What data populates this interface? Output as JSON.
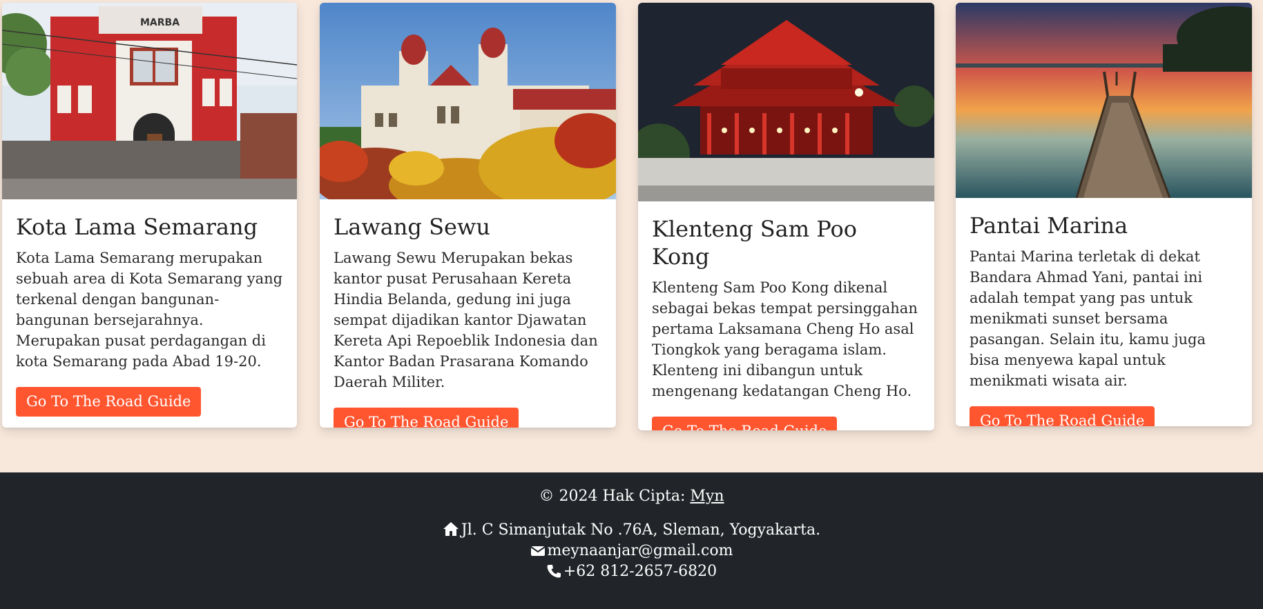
{
  "cards": [
    {
      "title": "Kota Lama Semarang",
      "text": "Kota Lama Semarang merupakan sebuah area di Kota Semarang yang terkenal dengan bangunan-bangunan bersejarahnya. Merupakan pusat perdagangan di kota Semarang pada Abad 19-20.",
      "button_label": "Go To The Road Guide",
      "image_sign": "MARBA",
      "image_icon": "colonial-building-photo"
    },
    {
      "title": "Lawang Sewu",
      "text": "Lawang Sewu Merupakan bekas kantor pusat Perusahaan Kereta Hindia Belanda, gedung ini juga sempat dijadikan kantor Djawatan Kereta Api Repoeblik Indonesia dan Kantor Badan Prasarana Komando Daerah Militer.",
      "button_label": "Go To The Road Guide",
      "image_icon": "twin-tower-building-photo"
    },
    {
      "title": "Klenteng Sam Poo Kong",
      "text": "Klenteng Sam Poo Kong dikenal sebagai bekas tempat persinggahan pertama Laksamana Cheng Ho asal Tiongkok yang beragama islam. Klenteng ini dibangun untuk mengenang kedatangan Cheng Ho.",
      "button_label": "Go To The Road Guide",
      "image_icon": "chinese-temple-photo"
    },
    {
      "title": "Pantai Marina",
      "text": "Pantai Marina terletak di dekat Bandara Ahmad Yani, pantai ini adalah tempat yang pas untuk menikmati sunset bersama pasangan. Selain itu, kamu juga bisa menyewa kapal untuk menikmati wisata air.",
      "button_label": "Go To The Road Guide",
      "image_icon": "sunset-pier-photo"
    }
  ],
  "footer": {
    "copyright_prefix": "© 2024 Hak Cipta: ",
    "copyright_link": "Myn",
    "address": "Jl. C Simanjutak No .76A, Sleman, Yogyakarta.",
    "email": "meynaanjar@gmail.com",
    "phone": "+62 812-2657-6820"
  },
  "colors": {
    "page_background": "#f8e8dc",
    "button": "#ff5630",
    "footer_background": "#212529"
  }
}
